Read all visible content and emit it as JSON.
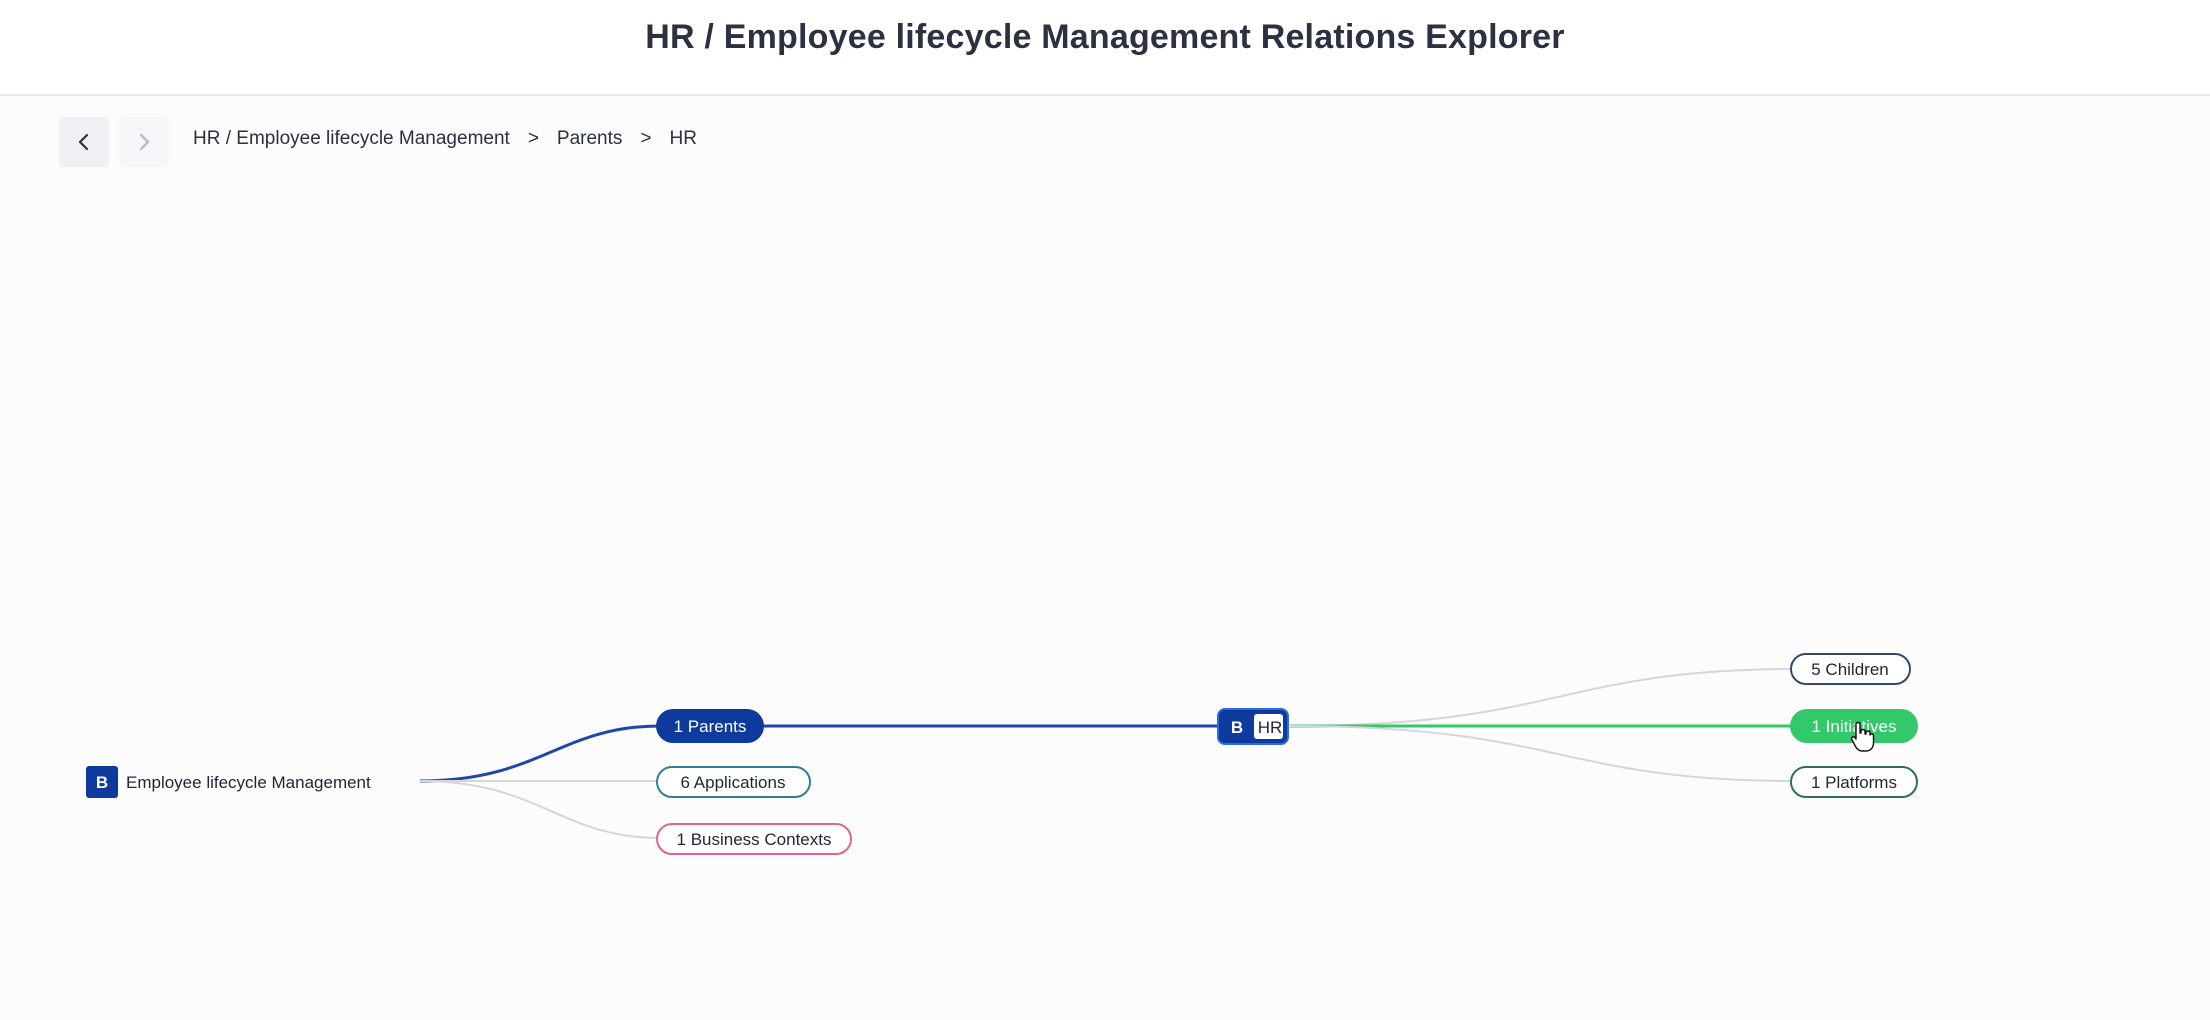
{
  "header": {
    "title": "HR / Employee lifecycle Management Relations Explorer"
  },
  "navigation": {
    "back_icon": "chevron-left-icon",
    "forward_icon": "chevron-right-icon"
  },
  "breadcrumb": {
    "items": [
      "HR / Employee lifecycle Management",
      "Parents",
      "HR"
    ],
    "separator": ">"
  },
  "graph": {
    "root": {
      "badge": "B",
      "label": "Employee lifecycle Management"
    },
    "root_relations": [
      {
        "label": "1 Parents",
        "active": true
      },
      {
        "label": "6 Applications",
        "active": false
      },
      {
        "label": "1 Business Contexts",
        "active": false
      }
    ],
    "focus": {
      "badge": "B",
      "label": "HR"
    },
    "focus_relations": [
      {
        "label": "5 Children",
        "active": false
      },
      {
        "label": "1 Initiatives",
        "active": true
      },
      {
        "label": "1 Platforms",
        "active": false
      }
    ]
  },
  "colors": {
    "primary_blue": "#0e3a9e",
    "active_green": "#33c86a",
    "applications_border": "#2e7f95",
    "business_contexts_border": "#e0648c",
    "children_border": "#34486e",
    "platforms_border": "#2f6e5a",
    "edge_inactive": "#d4d6da"
  }
}
